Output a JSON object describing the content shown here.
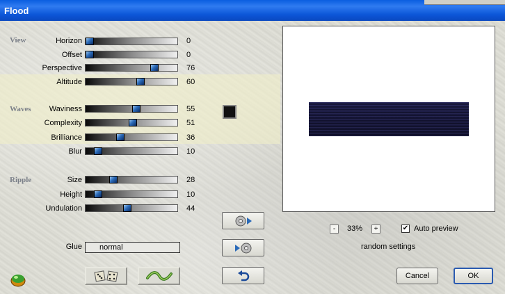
{
  "window": {
    "title": "Flood"
  },
  "sections": {
    "view": "View",
    "waves": "Waves",
    "ripple": "Ripple"
  },
  "controls": [
    {
      "id": "horizon",
      "label": "Horizon",
      "value": 0
    },
    {
      "id": "offset",
      "label": "Offset",
      "value": 0
    },
    {
      "id": "perspective",
      "label": "Perspective",
      "value": 76
    },
    {
      "id": "altitude",
      "label": "Altitude",
      "value": 60
    },
    {
      "id": "waviness",
      "label": "Waviness",
      "value": 55
    },
    {
      "id": "complexity",
      "label": "Complexity",
      "value": 51
    },
    {
      "id": "brilliance",
      "label": "Brilliance",
      "value": 36
    },
    {
      "id": "blur",
      "label": "Blur",
      "value": 10
    },
    {
      "id": "size",
      "label": "Size",
      "value": 28
    },
    {
      "id": "height",
      "label": "Height",
      "value": 10
    },
    {
      "id": "undulation",
      "label": "Undulation",
      "value": 44
    }
  ],
  "glue": {
    "label": "Glue",
    "value": "normal"
  },
  "preview": {
    "zoom": "33%",
    "zoom_minus": "-",
    "zoom_plus": "+",
    "auto_preview_label": "Auto preview",
    "auto_preview_checked": true,
    "random_settings_label": "random settings"
  },
  "buttons": {
    "cancel": "Cancel",
    "ok": "OK"
  },
  "colors": {
    "swatch": "#111111",
    "titlebar": "#0a5ee0"
  }
}
